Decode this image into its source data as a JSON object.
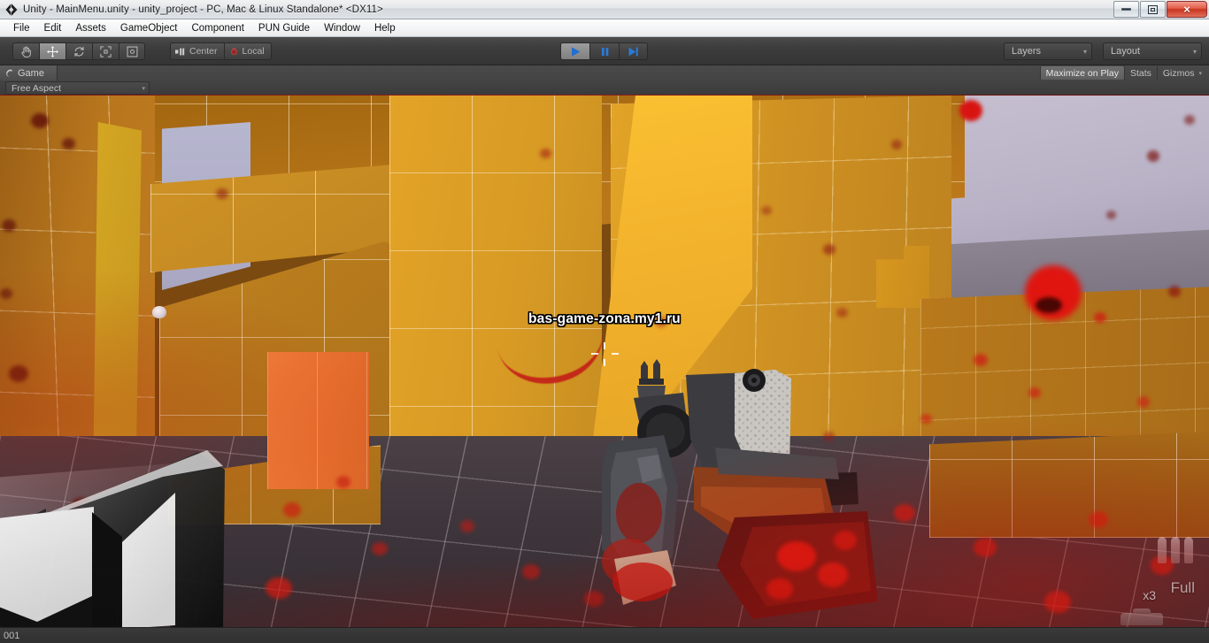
{
  "window": {
    "title": "Unity - MainMenu.unity - unity_project - PC, Mac & Linux Standalone* <DX11>",
    "app_icon": "unity-icon",
    "controls": {
      "minimize": "minimize-icon",
      "restore": "restore-icon",
      "close": "×"
    }
  },
  "menubar": {
    "items": [
      {
        "label": "File"
      },
      {
        "label": "Edit"
      },
      {
        "label": "Assets"
      },
      {
        "label": "GameObject"
      },
      {
        "label": "Component"
      },
      {
        "label": "PUN Guide"
      },
      {
        "label": "Window"
      },
      {
        "label": "Help"
      }
    ]
  },
  "toolbar": {
    "transform_tools": [
      {
        "name": "hand-tool",
        "icon": "hand-icon",
        "active": false
      },
      {
        "name": "move-tool",
        "icon": "move-icon",
        "active": true
      },
      {
        "name": "rotate-tool",
        "icon": "rotate-icon",
        "active": false
      },
      {
        "name": "scale-tool",
        "icon": "scale-icon",
        "active": false
      },
      {
        "name": "rect-tool",
        "icon": "rect-icon",
        "active": false
      }
    ],
    "pivot_mode": "Center",
    "pivot_rotation": "Local",
    "playback": [
      {
        "name": "play-button",
        "icon": "play-icon",
        "active": true
      },
      {
        "name": "pause-button",
        "icon": "pause-icon",
        "active": false
      },
      {
        "name": "step-button",
        "icon": "step-icon",
        "active": false
      }
    ],
    "layers_label": "Layers",
    "layout_label": "Layout",
    "dropdown_arrow": "▾"
  },
  "game_view": {
    "tab_label": "Game",
    "tab_icon": "game-view-icon",
    "aspect": "Free Aspect",
    "maximize_on_play": "Maximize on Play",
    "stats": "Stats",
    "gizmos": "Gizmos",
    "gizmos_arrow": "▾",
    "panel_menu_icon": "panel-menu-icon"
  },
  "scene": {
    "watermark_text": "bas-game-zona.my1.ru",
    "crosshair": "crosshair-icon",
    "weapon": "assault-rifle-viewmodel",
    "unity_splash_logo": "unity-logo-watermark",
    "colors": {
      "wall_orange": "#c08320",
      "wall_bright": "#fbc032",
      "crate_orange": "#e8702f",
      "floor_grey": "#3e363c",
      "sky_lavender": "#b9b2c6",
      "blood_red": "#c42018"
    }
  },
  "hud": {
    "grenade_count": "x3",
    "ammo_state": "Full",
    "bullet_icons": 3,
    "grenade_icon": "grenade-icon"
  },
  "statusbar": {
    "text": "001"
  }
}
